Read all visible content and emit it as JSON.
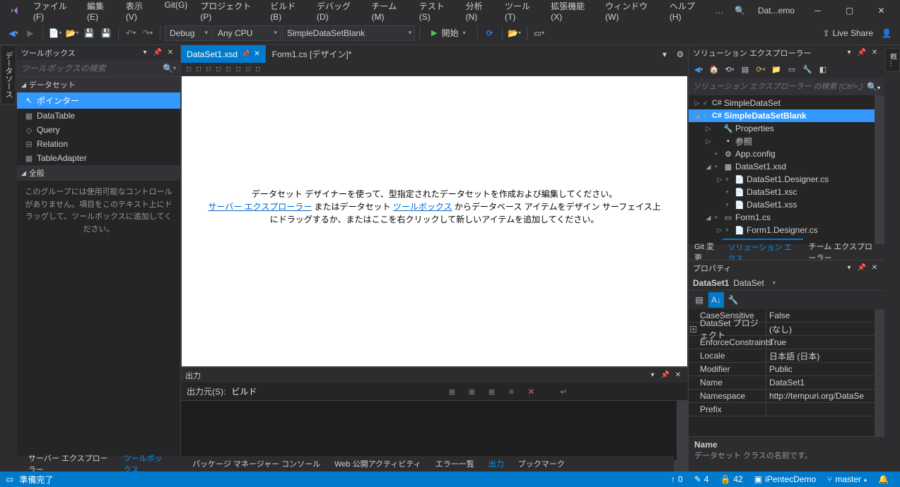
{
  "titlebar": {
    "menus": [
      "ファイル(F)",
      "編集(E)",
      "表示(V)",
      "Git(G)",
      "プロジェクト(P)",
      "ビルド(B)",
      "デバッグ(D)",
      "チーム(M)",
      "テスト(S)",
      "分析(N)",
      "ツール(T)",
      "拡張機能(X)",
      "ウィンドウ(W)",
      "ヘルプ(H)"
    ],
    "dots": "…",
    "project": "Dat...emo"
  },
  "toolbar": {
    "config": "Debug",
    "platform": "Any CPU",
    "target": "SimpleDataSetBlank",
    "start": "開始",
    "liveshare": "Live Share"
  },
  "left_edge_tab": "データソース",
  "toolbox": {
    "title": "ツールボックス",
    "search_placeholder": "ツールボックスの検索",
    "group1": "データセット",
    "items": [
      "ポインター",
      "DataTable",
      "Query",
      "Relation",
      "TableAdapter"
    ],
    "group2": "全般",
    "empty": "このグループには使用可能なコントロールがありません。項目をこのテキスト上にドラッグして、ツールボックスに追加してください。"
  },
  "tabs": {
    "active": "DataSet1.xsd",
    "inactive": "Form1.cs [デザイン]*"
  },
  "designer": {
    "line1": "データセット デザイナーを使って、型指定されたデータセットを作成および編集してください。",
    "link1": "サーバー エクスプローラー",
    "mid1": " またはデータセット ",
    "link2": "ツールボックス",
    "mid2": " からデータベース アイテムをデザイン サーフェイス上にドラッグするか、またはここを右クリックして新しいアイテムを追加してください。"
  },
  "output": {
    "title": "出力",
    "from_label": "出力元(S):",
    "from_value": "ビルド"
  },
  "bottom_left_tabs": [
    "サーバー エクスプローラー",
    "ツールボックス"
  ],
  "bottom_center_tabs": [
    "パッケージ マネージャー コンソール",
    "Web 公開アクティビティ",
    "エラー一覧",
    "出力",
    "ブックマーク"
  ],
  "solexp": {
    "title": "ソリューション エクスプローラー",
    "search_placeholder": "ソリューション エクスプローラー の検索 (Ctrl+;)",
    "tree": [
      {
        "indent": 0,
        "exp": "▷",
        "vcs": "✓",
        "ico": "C#",
        "label": "SimpleDataSet",
        "bold": false
      },
      {
        "indent": 0,
        "exp": "◢",
        "vcs": "+",
        "ico": "C#",
        "label": "SimpleDataSetBlank",
        "bold": true,
        "sel": true
      },
      {
        "indent": 1,
        "exp": "▷",
        "vcs": "",
        "ico": "🔧",
        "label": "Properties"
      },
      {
        "indent": 1,
        "exp": "▷",
        "vcs": "",
        "ico": "▪",
        "label": "参照"
      },
      {
        "indent": 1,
        "exp": "",
        "vcs": "+",
        "ico": "⚙",
        "label": "App.config"
      },
      {
        "indent": 1,
        "exp": "◢",
        "vcs": "+",
        "ico": "▦",
        "label": "DataSet1.xsd"
      },
      {
        "indent": 2,
        "exp": "▷",
        "vcs": "+",
        "ico": "📄",
        "label": "DataSet1.Designer.cs"
      },
      {
        "indent": 2,
        "exp": "",
        "vcs": "+",
        "ico": "📄",
        "label": "DataSet1.xsc"
      },
      {
        "indent": 2,
        "exp": "",
        "vcs": "+",
        "ico": "📄",
        "label": "DataSet1.xss"
      },
      {
        "indent": 1,
        "exp": "◢",
        "vcs": "+",
        "ico": "▭",
        "label": "Form1.cs"
      },
      {
        "indent": 2,
        "exp": "▷",
        "vcs": "+",
        "ico": "📄",
        "label": "Form1.Designer.cs"
      }
    ],
    "tabs": [
      "Git 変更",
      "ソリューション エクス...",
      "チーム エクスプローラー"
    ]
  },
  "props": {
    "title": "プロパティ",
    "obj_name": "DataSet1",
    "obj_type": "DataSet",
    "rows": [
      {
        "k": "CaseSensitive",
        "v": "False"
      },
      {
        "k": "DataSet プロジェクト",
        "v": "(なし)",
        "exp": "+"
      },
      {
        "k": "EnforceConstraints",
        "v": "True"
      },
      {
        "k": "Locale",
        "v": "日本語 (日本)"
      },
      {
        "k": "Modifier",
        "v": "Public"
      },
      {
        "k": "Name",
        "v": "DataSet1"
      },
      {
        "k": "Namespace",
        "v": "http://tempuri.org/DataSe"
      },
      {
        "k": "Prefix",
        "v": ""
      }
    ],
    "help_name": "Name",
    "help_desc": "データセット クラスの名前です。"
  },
  "right_edge_tab": "概…",
  "status": {
    "ready": "準備完了",
    "up": "0",
    "pencil": "4",
    "errors": "42",
    "repo": "iPentecDemo",
    "branch": "master"
  }
}
